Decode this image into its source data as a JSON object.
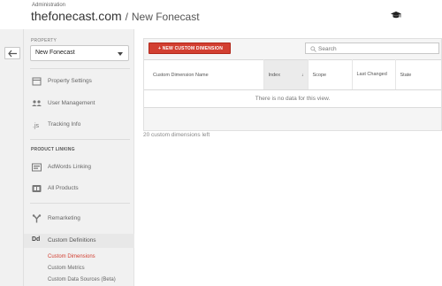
{
  "header": {
    "section": "Administration",
    "account": "thefonecast.com",
    "separator": "/",
    "property": "New Fonecast"
  },
  "sidebar": {
    "property_label": "PROPERTY",
    "property_value": "New Fonecast",
    "items": [
      {
        "label": "Property Settings",
        "icon": "settings-icon"
      },
      {
        "label": "User Management",
        "icon": "users-icon"
      },
      {
        "label": "Tracking Info",
        "icon": "js-icon"
      }
    ],
    "product_linking_label": "PRODUCT LINKING",
    "linking_items": [
      {
        "label": "AdWords Linking",
        "icon": "adwords-icon"
      },
      {
        "label": "All Products",
        "icon": "products-icon"
      }
    ],
    "remarketing": {
      "label": "Remarketing",
      "icon": "remarketing-icon"
    },
    "custom_definitions": {
      "label": "Custom Definitions",
      "icon_text": "Dd"
    },
    "sub_items": [
      {
        "label": "Custom Dimensions",
        "current": true
      },
      {
        "label": "Custom Metrics",
        "current": false
      },
      {
        "label": "Custom Data Sources (Beta)",
        "current": false
      }
    ]
  },
  "main": {
    "new_button": "+ NEW CUSTOM DIMENSION",
    "search_placeholder": "Search",
    "columns": {
      "name": "Custom Dimension Name",
      "index": "Index",
      "index_sort": "↓",
      "scope": "Scope",
      "last_changed": "Last Changed",
      "state": "State"
    },
    "empty_message": "There is no data for this view.",
    "footnote": "20 custom dimensions left"
  },
  "colors": {
    "accent": "#d23f31",
    "sidebar_bg": "#f1f1f1"
  }
}
